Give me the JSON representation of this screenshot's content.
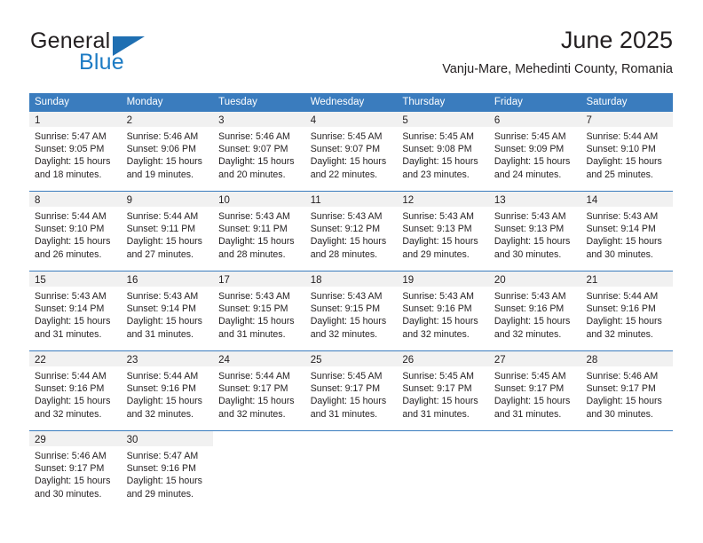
{
  "brand": {
    "word1": "General",
    "word2": "Blue",
    "triangle_color": "#1f6fb2",
    "blue_color": "#1c7bc4"
  },
  "header": {
    "title": "June 2025",
    "subtitle": "Vanju-Mare, Mehedinti County, Romania"
  },
  "theme": {
    "header_bg": "#3a7cbe",
    "header_text": "#ffffff",
    "daynum_bg": "#f1f1f1",
    "text": "#231f20"
  },
  "calendar": {
    "weekday_headers": [
      "Sunday",
      "Monday",
      "Tuesday",
      "Wednesday",
      "Thursday",
      "Friday",
      "Saturday"
    ],
    "weeks": [
      [
        {
          "day": "1",
          "sunrise": "Sunrise: 5:47 AM",
          "sunset": "Sunset: 9:05 PM",
          "daylight_l1": "Daylight: 15 hours",
          "daylight_l2": "and 18 minutes."
        },
        {
          "day": "2",
          "sunrise": "Sunrise: 5:46 AM",
          "sunset": "Sunset: 9:06 PM",
          "daylight_l1": "Daylight: 15 hours",
          "daylight_l2": "and 19 minutes."
        },
        {
          "day": "3",
          "sunrise": "Sunrise: 5:46 AM",
          "sunset": "Sunset: 9:07 PM",
          "daylight_l1": "Daylight: 15 hours",
          "daylight_l2": "and 20 minutes."
        },
        {
          "day": "4",
          "sunrise": "Sunrise: 5:45 AM",
          "sunset": "Sunset: 9:07 PM",
          "daylight_l1": "Daylight: 15 hours",
          "daylight_l2": "and 22 minutes."
        },
        {
          "day": "5",
          "sunrise": "Sunrise: 5:45 AM",
          "sunset": "Sunset: 9:08 PM",
          "daylight_l1": "Daylight: 15 hours",
          "daylight_l2": "and 23 minutes."
        },
        {
          "day": "6",
          "sunrise": "Sunrise: 5:45 AM",
          "sunset": "Sunset: 9:09 PM",
          "daylight_l1": "Daylight: 15 hours",
          "daylight_l2": "and 24 minutes."
        },
        {
          "day": "7",
          "sunrise": "Sunrise: 5:44 AM",
          "sunset": "Sunset: 9:10 PM",
          "daylight_l1": "Daylight: 15 hours",
          "daylight_l2": "and 25 minutes."
        }
      ],
      [
        {
          "day": "8",
          "sunrise": "Sunrise: 5:44 AM",
          "sunset": "Sunset: 9:10 PM",
          "daylight_l1": "Daylight: 15 hours",
          "daylight_l2": "and 26 minutes."
        },
        {
          "day": "9",
          "sunrise": "Sunrise: 5:44 AM",
          "sunset": "Sunset: 9:11 PM",
          "daylight_l1": "Daylight: 15 hours",
          "daylight_l2": "and 27 minutes."
        },
        {
          "day": "10",
          "sunrise": "Sunrise: 5:43 AM",
          "sunset": "Sunset: 9:11 PM",
          "daylight_l1": "Daylight: 15 hours",
          "daylight_l2": "and 28 minutes."
        },
        {
          "day": "11",
          "sunrise": "Sunrise: 5:43 AM",
          "sunset": "Sunset: 9:12 PM",
          "daylight_l1": "Daylight: 15 hours",
          "daylight_l2": "and 28 minutes."
        },
        {
          "day": "12",
          "sunrise": "Sunrise: 5:43 AM",
          "sunset": "Sunset: 9:13 PM",
          "daylight_l1": "Daylight: 15 hours",
          "daylight_l2": "and 29 minutes."
        },
        {
          "day": "13",
          "sunrise": "Sunrise: 5:43 AM",
          "sunset": "Sunset: 9:13 PM",
          "daylight_l1": "Daylight: 15 hours",
          "daylight_l2": "and 30 minutes."
        },
        {
          "day": "14",
          "sunrise": "Sunrise: 5:43 AM",
          "sunset": "Sunset: 9:14 PM",
          "daylight_l1": "Daylight: 15 hours",
          "daylight_l2": "and 30 minutes."
        }
      ],
      [
        {
          "day": "15",
          "sunrise": "Sunrise: 5:43 AM",
          "sunset": "Sunset: 9:14 PM",
          "daylight_l1": "Daylight: 15 hours",
          "daylight_l2": "and 31 minutes."
        },
        {
          "day": "16",
          "sunrise": "Sunrise: 5:43 AM",
          "sunset": "Sunset: 9:14 PM",
          "daylight_l1": "Daylight: 15 hours",
          "daylight_l2": "and 31 minutes."
        },
        {
          "day": "17",
          "sunrise": "Sunrise: 5:43 AM",
          "sunset": "Sunset: 9:15 PM",
          "daylight_l1": "Daylight: 15 hours",
          "daylight_l2": "and 31 minutes."
        },
        {
          "day": "18",
          "sunrise": "Sunrise: 5:43 AM",
          "sunset": "Sunset: 9:15 PM",
          "daylight_l1": "Daylight: 15 hours",
          "daylight_l2": "and 32 minutes."
        },
        {
          "day": "19",
          "sunrise": "Sunrise: 5:43 AM",
          "sunset": "Sunset: 9:16 PM",
          "daylight_l1": "Daylight: 15 hours",
          "daylight_l2": "and 32 minutes."
        },
        {
          "day": "20",
          "sunrise": "Sunrise: 5:43 AM",
          "sunset": "Sunset: 9:16 PM",
          "daylight_l1": "Daylight: 15 hours",
          "daylight_l2": "and 32 minutes."
        },
        {
          "day": "21",
          "sunrise": "Sunrise: 5:44 AM",
          "sunset": "Sunset: 9:16 PM",
          "daylight_l1": "Daylight: 15 hours",
          "daylight_l2": "and 32 minutes."
        }
      ],
      [
        {
          "day": "22",
          "sunrise": "Sunrise: 5:44 AM",
          "sunset": "Sunset: 9:16 PM",
          "daylight_l1": "Daylight: 15 hours",
          "daylight_l2": "and 32 minutes."
        },
        {
          "day": "23",
          "sunrise": "Sunrise: 5:44 AM",
          "sunset": "Sunset: 9:16 PM",
          "daylight_l1": "Daylight: 15 hours",
          "daylight_l2": "and 32 minutes."
        },
        {
          "day": "24",
          "sunrise": "Sunrise: 5:44 AM",
          "sunset": "Sunset: 9:17 PM",
          "daylight_l1": "Daylight: 15 hours",
          "daylight_l2": "and 32 minutes."
        },
        {
          "day": "25",
          "sunrise": "Sunrise: 5:45 AM",
          "sunset": "Sunset: 9:17 PM",
          "daylight_l1": "Daylight: 15 hours",
          "daylight_l2": "and 31 minutes."
        },
        {
          "day": "26",
          "sunrise": "Sunrise: 5:45 AM",
          "sunset": "Sunset: 9:17 PM",
          "daylight_l1": "Daylight: 15 hours",
          "daylight_l2": "and 31 minutes."
        },
        {
          "day": "27",
          "sunrise": "Sunrise: 5:45 AM",
          "sunset": "Sunset: 9:17 PM",
          "daylight_l1": "Daylight: 15 hours",
          "daylight_l2": "and 31 minutes."
        },
        {
          "day": "28",
          "sunrise": "Sunrise: 5:46 AM",
          "sunset": "Sunset: 9:17 PM",
          "daylight_l1": "Daylight: 15 hours",
          "daylight_l2": "and 30 minutes."
        }
      ],
      [
        {
          "day": "29",
          "sunrise": "Sunrise: 5:46 AM",
          "sunset": "Sunset: 9:17 PM",
          "daylight_l1": "Daylight: 15 hours",
          "daylight_l2": "and 30 minutes."
        },
        {
          "day": "30",
          "sunrise": "Sunrise: 5:47 AM",
          "sunset": "Sunset: 9:16 PM",
          "daylight_l1": "Daylight: 15 hours",
          "daylight_l2": "and 29 minutes."
        },
        {
          "day": "",
          "sunrise": "",
          "sunset": "",
          "daylight_l1": "",
          "daylight_l2": ""
        },
        {
          "day": "",
          "sunrise": "",
          "sunset": "",
          "daylight_l1": "",
          "daylight_l2": ""
        },
        {
          "day": "",
          "sunrise": "",
          "sunset": "",
          "daylight_l1": "",
          "daylight_l2": ""
        },
        {
          "day": "",
          "sunrise": "",
          "sunset": "",
          "daylight_l1": "",
          "daylight_l2": ""
        },
        {
          "day": "",
          "sunrise": "",
          "sunset": "",
          "daylight_l1": "",
          "daylight_l2": ""
        }
      ]
    ]
  }
}
